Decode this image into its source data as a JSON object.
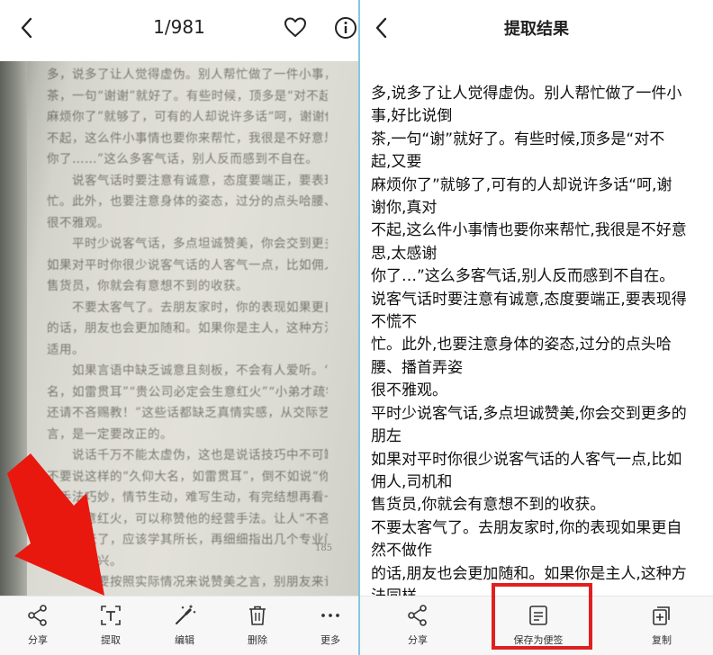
{
  "left": {
    "counter": "1/981",
    "icons": {
      "back": "back-chevron-icon",
      "favorite": "heart-outline-icon",
      "info": "info-circle-icon"
    },
    "page_number": "185",
    "page_lines": [
      "多，说多了让人觉得虚伪。别人帮忙做了一件小事，好比说倒",
      "茶，一句“谢谢”就好了。有些时候，顶多是“对不起，又要",
      "麻烦你了”就够了，可有的人却说许多话“呵，谢谢你，真对",
      "不起，这么件小事情也要你来帮忙，我很是不好意思，太感谢",
      "你了……”这么多客气话，别人反而感到不自在。",
      "　　说客气话时要注意有诚意，态度要端正，要表现得不慌不",
      "忙。此外，也要注意身体的姿态，过分的点头哈腰、播首弄姿",
      "很不雅观。",
      "　　平时少说客气话，多点坦诚赞美，你会交到更多的朋友。",
      "如果对平时你很少说客气话的人客气一点，比如佣人，司机和",
      "售货员，你就会有意想不到的收获。",
      "　　不要太客气了。去朋友家时，你的表现如果更自然不做作",
      "的话，朋友也会更加随和。如果你是主人，这种方法同样",
      "适用。",
      "　　如果言语中缺乏诚意且刻板，不会有人爱听。“久仰大",
      "名，如雷贯耳”“贵公司必定会生意红火”“小弟才疏学浅，",
      "还请不吝赐教！”这些话都缺乏真情实感，从交际艺术的层面而",
      "言，是一定要改正的。",
      "　　说话千万不能太虚伪，这也是说话技巧中不可缺少的。与其",
      "不要说这样的“久仰大名，如雷贯耳”，倒不如说“你小说的叙",
      "述手法巧妙，情节生动，难写生动，有完结想再看一遍”等话。假如恭维",
      "他人生意红火，可以称赞他的经营手法。让人“不吝赐教”这",
      "样太夸张了，应该学其所长，再细细指出几个专业问题，会使",
      "对方更高兴。",
      "　　一定要按照实际情况来说赞美之言，别朋友来访与其随便夸"
    ],
    "toolbar": [
      {
        "id": "share",
        "label": "分享",
        "icon": "share-icon"
      },
      {
        "id": "extract",
        "label": "提取",
        "icon": "extract-text-icon"
      },
      {
        "id": "edit",
        "label": "编辑",
        "icon": "magic-wand-icon"
      },
      {
        "id": "delete",
        "label": "删除",
        "icon": "trash-icon"
      },
      {
        "id": "more",
        "label": "更多",
        "icon": "more-dots-icon"
      }
    ]
  },
  "right": {
    "title": "提取结果",
    "icons": {
      "back": "back-chevron-icon"
    },
    "result_lines": [
      "多,说多了让人觉得虚伪。别人帮忙做了一件小",
      "事,好比说倒",
      "茶,一句“谢”就好了。有些时候,顶多是“对不",
      "起,又要",
      "麻烦你了”就够了,可有的人却说许多话“呵,谢",
      "谢你,真对",
      "不起,这么件小事情也要你来帮忙,我很是不好意",
      "思,太感谢",
      "你了…”这么多客气话,别人反而感到不自在。",
      "说客气话时要注意有诚意,态度要端正,要表现得",
      "不慌不",
      "忙。此外,也要注意身体的姿态,过分的点头哈",
      "腰、播首弄姿",
      "很不雅观。",
      "平时少说客气话,多点坦诚赞美,你会交到更多的",
      "朋左",
      "如果对平时你很少说客气话的人客气一点,比如",
      "佣人,司机和",
      "售货员,你就会有意想不到的收获。",
      "不要太客气了。去朋友家时,你的表现如果更自",
      "然不做作",
      "的话,朋友也会更加随和。如果你是主人,这种方",
      "法同样"
    ],
    "toolbar": [
      {
        "id": "share",
        "label": "分享",
        "icon": "share-icon"
      },
      {
        "id": "save-note",
        "label": "保存为便签",
        "icon": "note-icon"
      },
      {
        "id": "copy",
        "label": "复制",
        "icon": "copy-icon"
      }
    ]
  },
  "annotations": {
    "arrow_color": "#e8180f",
    "highlight_color": "#e02020",
    "arrow_target": "extract",
    "highlight_target": "save-note"
  },
  "colors": {
    "divider": "#86c6df",
    "toolbar_bg": "#f7f7f7"
  }
}
